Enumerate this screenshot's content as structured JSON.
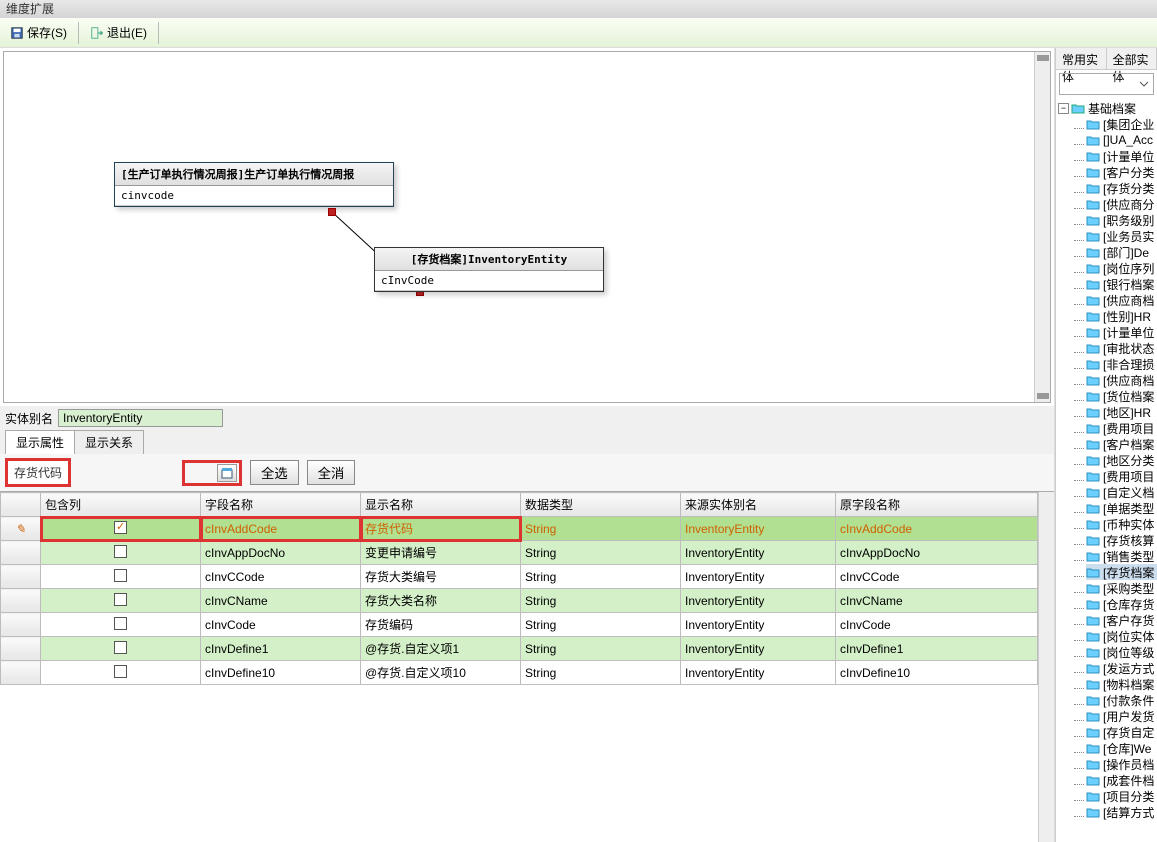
{
  "title": "维度扩展",
  "toolbar": {
    "save": "保存(S)",
    "exit": "退出(E)"
  },
  "canvas": {
    "entity1": {
      "title": "[生产订单执行情况周报]生产订单执行情况周报",
      "field": "cinvcode"
    },
    "entity2": {
      "title": "[存货档案]InventoryEntity",
      "field": "cInvCode"
    }
  },
  "alias": {
    "label": "实体别名",
    "value": "InventoryEntity"
  },
  "tabs": {
    "t1": "显示属性",
    "t2": "显示关系"
  },
  "filter": {
    "text": "存货代码",
    "selectAll": "全选",
    "selectNone": "全消"
  },
  "grid": {
    "cols": {
      "c0": "",
      "c1": "包含列",
      "c2": "字段名称",
      "c3": "显示名称",
      "c4": "数据类型",
      "c5": "来源实体别名",
      "c6": "原字段名称"
    },
    "r0": {
      "chk": true,
      "f": "cInvAddCode",
      "d": "存货代码",
      "t": "String",
      "s": "InventoryEntity",
      "o": "cInvAddCode"
    },
    "r1": {
      "chk": false,
      "f": "cInvAppDocNo",
      "d": "变更申请编号",
      "t": "String",
      "s": "InventoryEntity",
      "o": "cInvAppDocNo"
    },
    "r2": {
      "chk": false,
      "f": "cInvCCode",
      "d": "存货大类编号",
      "t": "String",
      "s": "InventoryEntity",
      "o": "cInvCCode"
    },
    "r3": {
      "chk": false,
      "f": "cInvCName",
      "d": "存货大类名称",
      "t": "String",
      "s": "InventoryEntity",
      "o": "cInvCName"
    },
    "r4": {
      "chk": false,
      "f": "cInvCode",
      "d": "存货编码",
      "t": "String",
      "s": "InventoryEntity",
      "o": "cInvCode"
    },
    "r5": {
      "chk": false,
      "f": "cInvDefine1",
      "d": "@存货.自定义项1",
      "t": "String",
      "s": "InventoryEntity",
      "o": "cInvDefine1"
    },
    "r6": {
      "chk": false,
      "f": "cInvDefine10",
      "d": "@存货.自定义项10",
      "t": "String",
      "s": "InventoryEntity",
      "o": "cInvDefine10"
    }
  },
  "right": {
    "tab1": "常用实体",
    "tab2": "全部实体",
    "root": "基础档案",
    "items": [
      "[集团企业",
      "[]UA_Acc",
      "[计量单位",
      "[客户分类",
      "[存货分类",
      "[供应商分",
      "[职务级别",
      "[业务员实",
      "[部门]De",
      "[岗位序列",
      "[银行档案",
      "[供应商档",
      "[性别]HR",
      "[计量单位",
      "[审批状态",
      "[非合理损",
      "[供应商档",
      "[货位档案",
      "[地区]HR",
      "[费用项目",
      "[客户档案",
      "[地区分类",
      "[费用项目",
      "[自定义档",
      "[单据类型",
      "[币种实体",
      "[存货核算",
      "[销售类型",
      "[存货档案",
      "[采购类型",
      "[仓库存货",
      "[客户存货",
      "[岗位实体",
      "[岗位等级",
      "[发运方式",
      "[物料档案",
      "[付款条件",
      "[用户发货",
      "[存货自定",
      "[仓库]We",
      "[操作员档",
      "[成套件档",
      "[项目分类",
      "[结算方式"
    ]
  }
}
